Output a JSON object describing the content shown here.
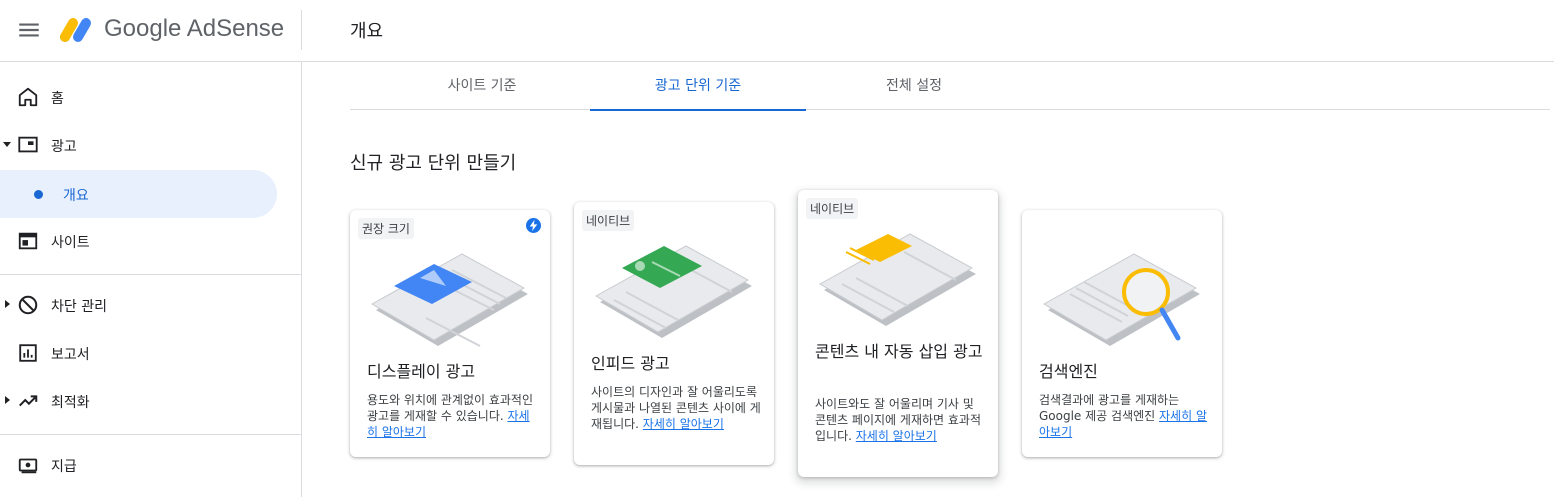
{
  "app": {
    "brand": "Google AdSense",
    "page_title": "개요"
  },
  "sidebar": {
    "items": [
      {
        "label": "홈",
        "icon": "home-icon"
      },
      {
        "label": "광고",
        "icon": "ads-icon"
      },
      {
        "label": "개요",
        "icon": "dot-icon",
        "active": true
      },
      {
        "label": "사이트",
        "icon": "sites-icon"
      },
      {
        "label": "차단 관리",
        "icon": "block-icon"
      },
      {
        "label": "보고서",
        "icon": "reports-icon"
      },
      {
        "label": "최적화",
        "icon": "optimize-icon"
      },
      {
        "label": "지급",
        "icon": "payments-icon"
      }
    ]
  },
  "tabs": [
    {
      "label": "사이트 기준"
    },
    {
      "label": "광고 단위 기준",
      "active": true
    },
    {
      "label": "전체 설정"
    }
  ],
  "section_title": "신규 광고 단위 만들기",
  "cards": [
    {
      "badge": "권장 크기",
      "title": "디스플레이 광고",
      "desc": "용도와 위치에 관계없이 효과적인 광고를 게재할 수 있습니다. ",
      "link": "자세히 알아보기"
    },
    {
      "badge": "네이티브",
      "title": "인피드 광고",
      "desc": "사이트의 디자인과 잘 어울리도록 게시물과 나열된 콘텐츠 사이에 게재됩니다. ",
      "link": "자세히 알아보기"
    },
    {
      "badge": "네이티브",
      "title": "콘텐츠 내 자동 삽입 광고",
      "desc": "사이트와도 잘 어울리며 기사 및 콘텐츠 페이지에 게재하면 효과적입니다. ",
      "link": "자세히 알아보기"
    },
    {
      "badge": "",
      "title": "검색엔진",
      "desc": "검색결과에 광고를 게재하는 Google 제공 검색엔진 ",
      "link": "자세히 알아보기"
    }
  ],
  "colors": {
    "accent": "#1967d2",
    "active_bg": "#e8f0fe",
    "display_ad": "#4285f4",
    "infeed_ad": "#34a853",
    "incontent_ad": "#fbbc04",
    "search_ring": "#fbbc04"
  }
}
